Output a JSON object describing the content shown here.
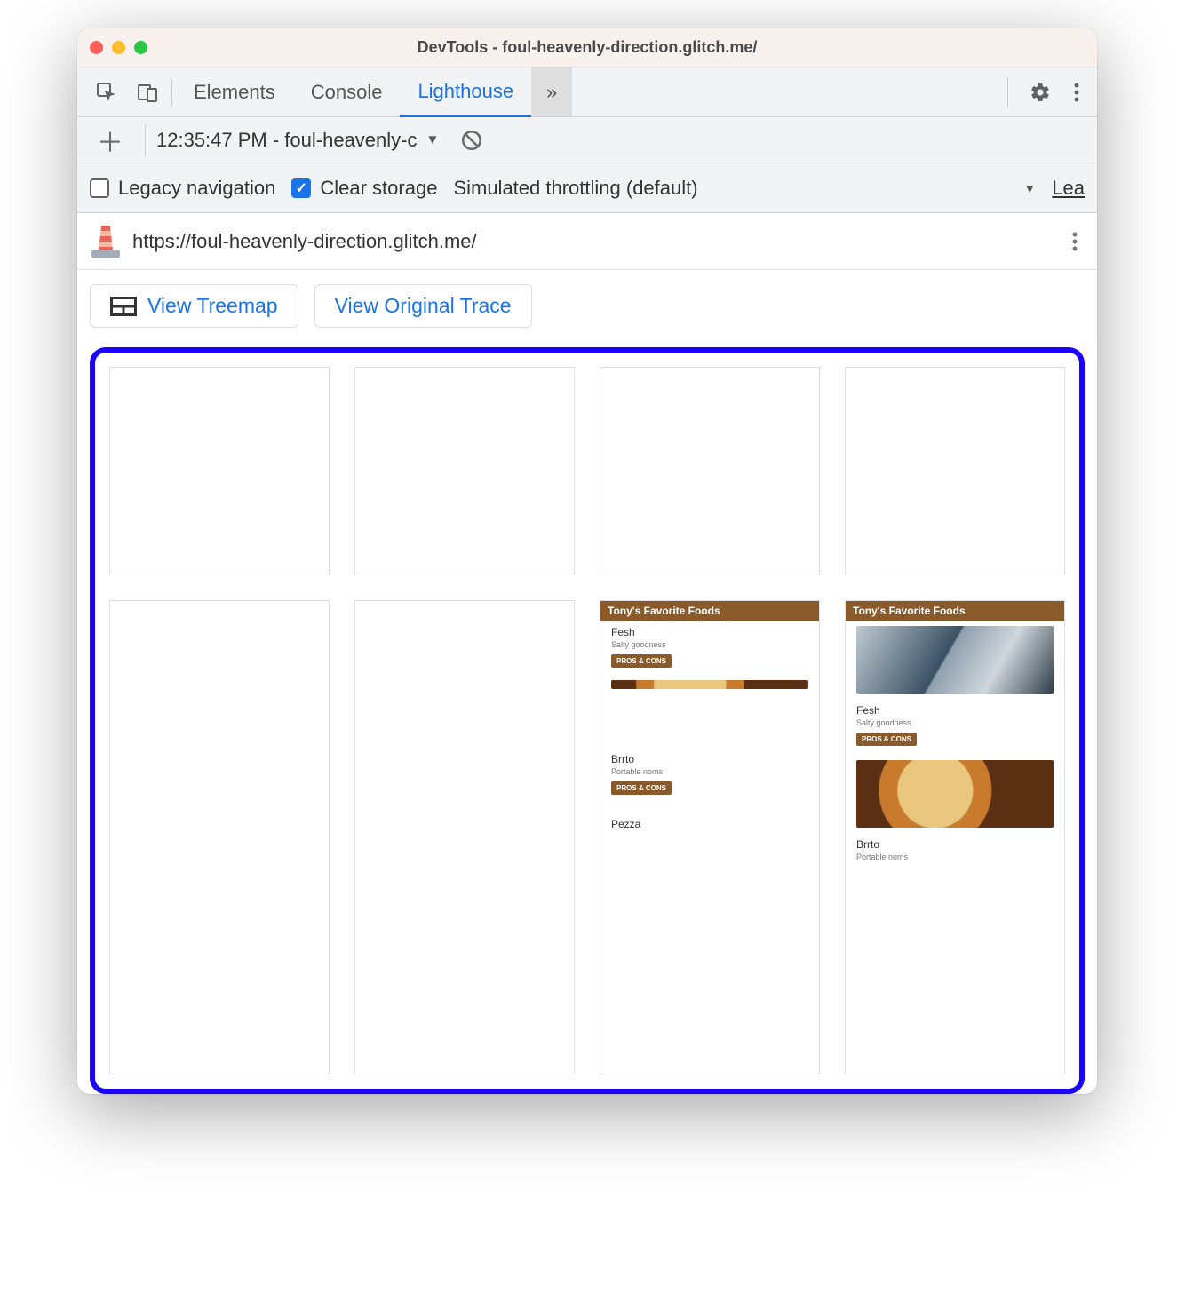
{
  "window": {
    "title": "DevTools - foul-heavenly-direction.glitch.me/"
  },
  "toolbar": {
    "tabs": [
      "Elements",
      "Console",
      "Lighthouse"
    ],
    "active_tab": "Lighthouse",
    "more_glyph": "»"
  },
  "lh_top": {
    "selected_report": "12:35:47 PM - foul-heavenly-c"
  },
  "lh_options": {
    "legacy_label": "Legacy navigation",
    "legacy_checked": false,
    "clear_label": "Clear storage",
    "clear_checked": true,
    "throttling_label": "Simulated throttling (default)",
    "learn_label": "Lea"
  },
  "url_row": {
    "url": "https://foul-heavenly-direction.glitch.me/"
  },
  "buttons": {
    "treemap": "View Treemap",
    "trace": "View Original Trace"
  },
  "filmstrip": {
    "frame7": {
      "header": "Tony's Favorite Foods",
      "items": [
        {
          "name": "Fesh",
          "sub": "Salty goodness",
          "btn": "PROS & CONS"
        },
        {
          "name": "Brrto",
          "sub": "Portable noms",
          "btn": "PROS & CONS"
        },
        {
          "name": "Pezza",
          "sub": "",
          "btn": ""
        }
      ]
    },
    "frame8": {
      "header": "Tony's Favorite Foods",
      "items": [
        {
          "name": "Fesh",
          "sub": "Salty goodness",
          "btn": "PROS & CONS"
        },
        {
          "name": "Brrto",
          "sub": "Portable noms",
          "btn": ""
        }
      ]
    }
  }
}
